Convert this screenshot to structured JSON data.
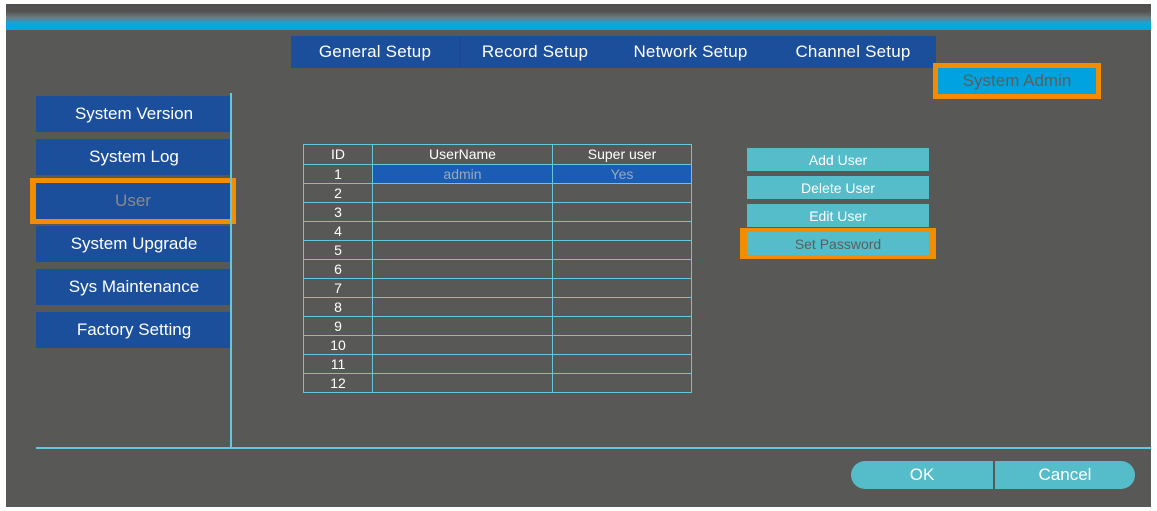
{
  "window": {
    "background_color": "#585856",
    "header_accent_color": "#00a8e0"
  },
  "theme": {
    "tab_blue": "#1b4f9c",
    "highlight_orange": "#f28c00",
    "active_cyan": "#00a3e0",
    "action_teal": "#55bcca",
    "table_border_cyan": "#63c8dc",
    "row_select_blue": "#1b5cb4",
    "muted_text": "#5d5d5d"
  },
  "tabs": [
    {
      "label": "General Setup",
      "active": false
    },
    {
      "label": "Record Setup",
      "active": false
    },
    {
      "label": "Network Setup",
      "active": false
    },
    {
      "label": "Channel Setup",
      "active": false
    },
    {
      "label": "System Admin",
      "active": true
    }
  ],
  "sidebar": {
    "items": [
      {
        "label": "System Version",
        "selected": false
      },
      {
        "label": "System Log",
        "selected": false
      },
      {
        "label": "User",
        "selected": true
      },
      {
        "label": "System Upgrade",
        "selected": false
      },
      {
        "label": "Sys Maintenance",
        "selected": false
      },
      {
        "label": "Factory Setting",
        "selected": false
      }
    ]
  },
  "user_table": {
    "columns": [
      "ID",
      "UserName",
      "Super user"
    ],
    "rows": [
      {
        "id": "1",
        "username": "admin",
        "super_user": "Yes",
        "selected": true
      },
      {
        "id": "2",
        "username": "",
        "super_user": "",
        "selected": false
      },
      {
        "id": "3",
        "username": "",
        "super_user": "",
        "selected": false
      },
      {
        "id": "4",
        "username": "",
        "super_user": "",
        "selected": false
      },
      {
        "id": "5",
        "username": "",
        "super_user": "",
        "selected": false
      },
      {
        "id": "6",
        "username": "",
        "super_user": "",
        "selected": false
      },
      {
        "id": "7",
        "username": "",
        "super_user": "",
        "selected": false
      },
      {
        "id": "8",
        "username": "",
        "super_user": "",
        "selected": false
      },
      {
        "id": "9",
        "username": "",
        "super_user": "",
        "selected": false
      },
      {
        "id": "10",
        "username": "",
        "super_user": "",
        "selected": false
      },
      {
        "id": "11",
        "username": "",
        "super_user": "",
        "selected": false
      },
      {
        "id": "12",
        "username": "",
        "super_user": "",
        "selected": false
      }
    ]
  },
  "actions": [
    {
      "label": "Add User",
      "selected": false
    },
    {
      "label": "Delete User",
      "selected": false
    },
    {
      "label": "Edit User",
      "selected": false
    },
    {
      "label": "Set Password",
      "selected": true
    }
  ],
  "footer": {
    "ok_label": "OK",
    "cancel_label": "Cancel"
  }
}
